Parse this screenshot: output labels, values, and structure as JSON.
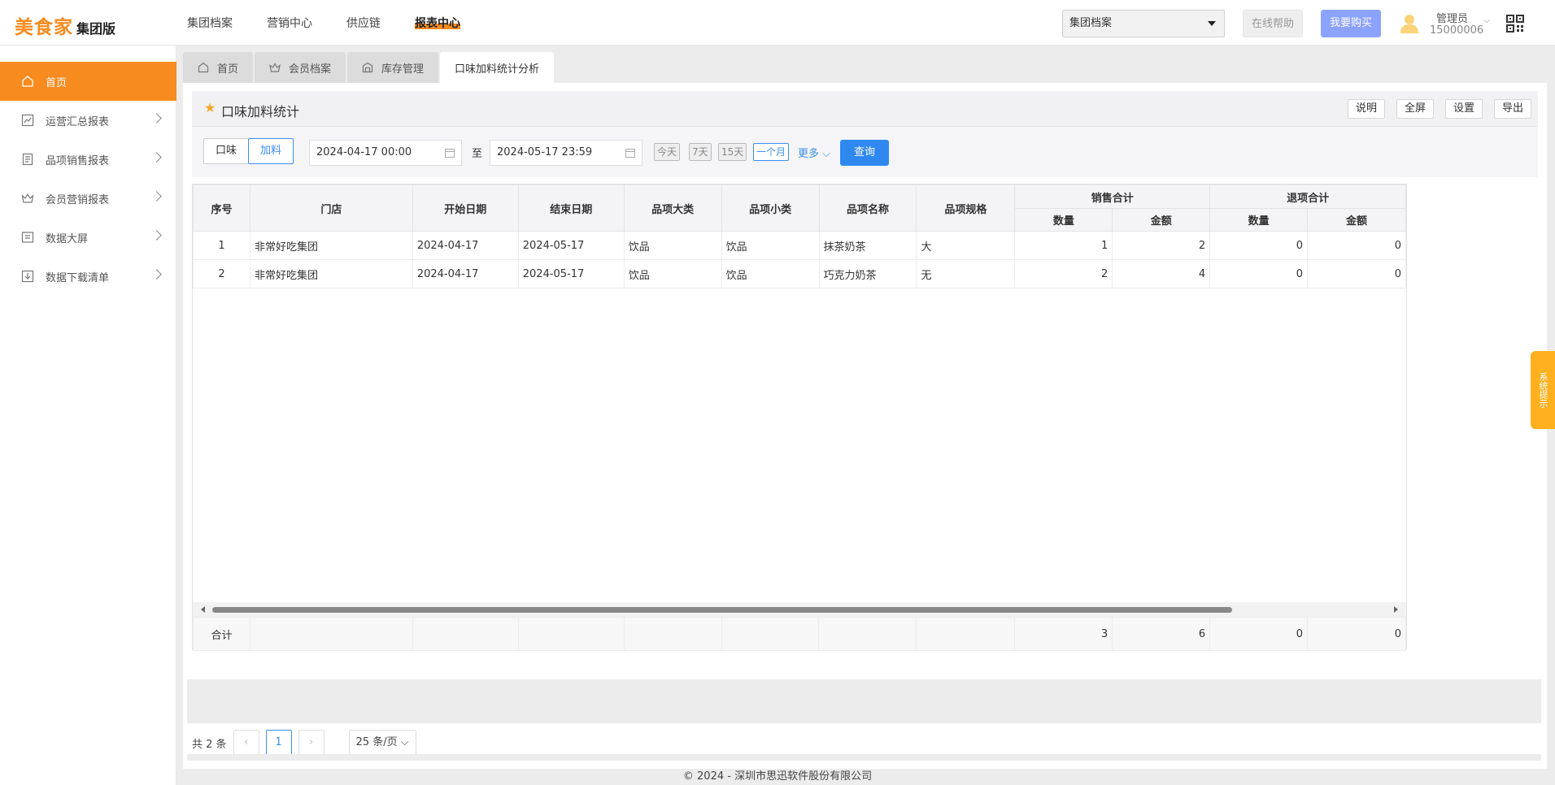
{
  "header": {
    "logo_main": "美食家",
    "logo_sub": "集团版",
    "nav": [
      {
        "label": "集团档案"
      },
      {
        "label": "营销中心"
      },
      {
        "label": "供应链"
      },
      {
        "label": "报表中心"
      }
    ],
    "org_select": "集团档案",
    "help_label": "在线帮助",
    "buy_label": "我要购买",
    "user_name": "管理员",
    "user_id": "15000006",
    "accent_color": "#f68b1f"
  },
  "sidebar": {
    "items": [
      {
        "label": "首页",
        "icon": "home-icon"
      },
      {
        "label": "运营汇总报表",
        "icon": "chart-line-icon"
      },
      {
        "label": "品项销售报表",
        "icon": "receipt-icon"
      },
      {
        "label": "会员营销报表",
        "icon": "crown-icon"
      },
      {
        "label": "数据大屏",
        "icon": "screen-icon"
      },
      {
        "label": "数据下载清单",
        "icon": "download-list-icon"
      }
    ]
  },
  "tabs": [
    {
      "label": "首页"
    },
    {
      "label": "会员档案"
    },
    {
      "label": "库存管理"
    },
    {
      "label": "口味加料统计分析"
    }
  ],
  "page": {
    "title": "口味加料统计",
    "tools": [
      "说明",
      "全屏",
      "设置",
      "导出"
    ]
  },
  "filters": {
    "segments": [
      "口味",
      "加料"
    ],
    "start_date": "2024-04-17 00:00",
    "end_date": "2024-05-17 23:59",
    "to_label": "至",
    "quick": [
      "今天",
      "7天",
      "15天",
      "一个月"
    ],
    "more_label": "更多",
    "query_label": "查询"
  },
  "table": {
    "headers": {
      "index": "序号",
      "store": "门店",
      "start": "开始日期",
      "end": "结束日期",
      "cat_big": "品项大类",
      "cat_small": "品项小类",
      "item_name": "品项名称",
      "spec": "品项规格",
      "sales_group": "销售合计",
      "refund_group": "退项合计",
      "qty": "数量",
      "amount": "金额"
    },
    "rows": [
      {
        "index": "1",
        "store": "非常好吃集团",
        "start": "2024-04-17",
        "end": "2024-05-17",
        "cat_big": "饮品",
        "cat_small": "饮品",
        "item_name": "抹茶奶茶",
        "spec": "大",
        "sale_qty": "1",
        "sale_amt": "2",
        "ref_qty": "0",
        "ref_amt": "0"
      },
      {
        "index": "2",
        "store": "非常好吃集团",
        "start": "2024-04-17",
        "end": "2024-05-17",
        "cat_big": "饮品",
        "cat_small": "饮品",
        "item_name": "巧克力奶茶",
        "spec": "无",
        "sale_qty": "2",
        "sale_amt": "4",
        "ref_qty": "0",
        "ref_amt": "0"
      }
    ],
    "summary": {
      "label": "合计",
      "sale_qty": "3",
      "sale_amt": "6",
      "ref_qty": "0",
      "ref_amt": "0"
    }
  },
  "pager": {
    "total_text": "共 2 条",
    "current_page": "1",
    "page_size": "25 条/页"
  },
  "footer": "© 2024 - 深圳市思迅软件股份有限公司",
  "sys_tip": "系统提示"
}
